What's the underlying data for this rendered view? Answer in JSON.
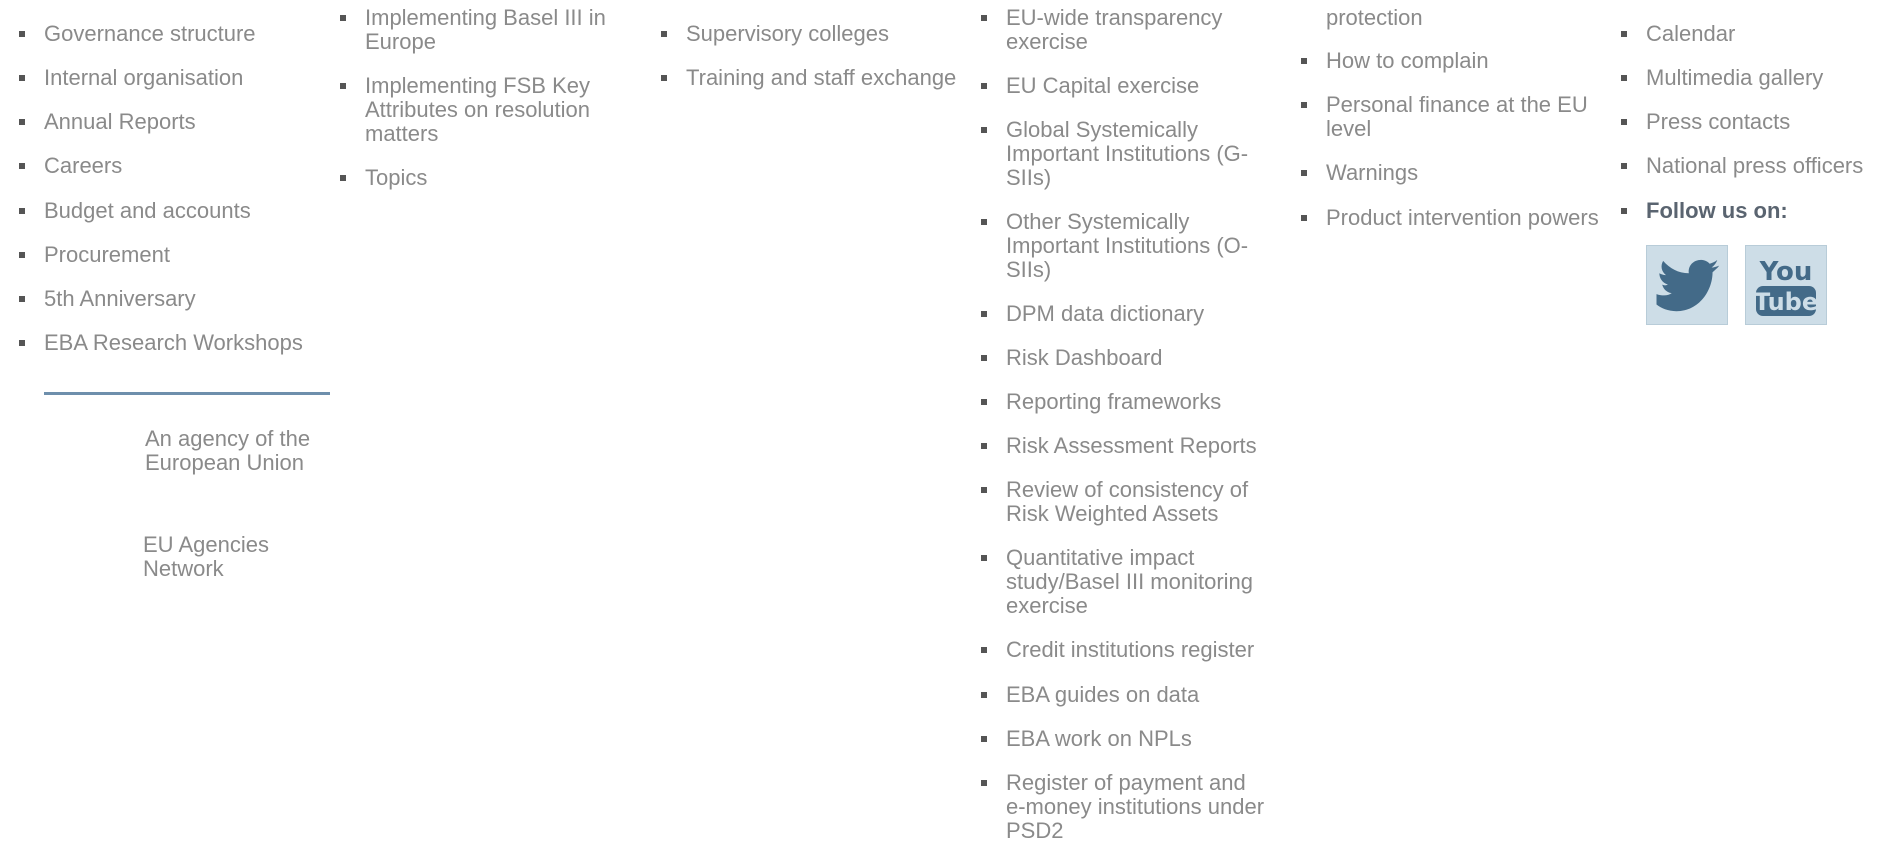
{
  "columns": [
    {
      "items": [
        {
          "label": "Governance structure"
        },
        {
          "label": "Internal organisation"
        },
        {
          "label": "Annual Reports"
        },
        {
          "label": "Careers"
        },
        {
          "label": "Budget and accounts"
        },
        {
          "label": "Procurement"
        },
        {
          "label": "5th Anniversary"
        },
        {
          "label": "EBA Research Workshops"
        }
      ]
    },
    {
      "items": [
        {
          "label": "Implementing Basel III in Europe"
        },
        {
          "label": "Implementing FSB Key Attributes on resolution matters"
        },
        {
          "label": "Topics"
        }
      ]
    },
    {
      "items": [
        {
          "label": "Supervisory colleges"
        },
        {
          "label": "Training and staff exchange"
        }
      ]
    },
    {
      "items": [
        {
          "label": "EU-wide transparency exercise"
        },
        {
          "label": "EU Capital exercise"
        },
        {
          "label": "Global Systemically Important Institutions (G-SIIs)"
        },
        {
          "label": "Other Systemically Important Institutions (O-SIIs)"
        },
        {
          "label": "DPM data dictionary"
        },
        {
          "label": "Risk Dashboard"
        },
        {
          "label": "Reporting frameworks"
        },
        {
          "label": "Risk Assessment Reports"
        },
        {
          "label": "Review of consistency of Risk Weighted Assets"
        },
        {
          "label": "Quantitative impact study/Basel III monitoring exercise"
        },
        {
          "label": "Credit institutions register"
        },
        {
          "label": "EBA guides on data"
        },
        {
          "label": "EBA work on NPLs"
        },
        {
          "label": "Register of payment and e-money institutions under PSD2"
        }
      ]
    },
    {
      "partial_top": "protection",
      "items": [
        {
          "label": "How to complain"
        },
        {
          "label": "Personal finance at the EU level"
        },
        {
          "label": "Warnings"
        },
        {
          "label": "Product intervention powers"
        }
      ]
    },
    {
      "items": [
        {
          "label": "Calendar"
        },
        {
          "label": "Multimedia gallery"
        },
        {
          "label": "Press contacts"
        },
        {
          "label": "National press officers"
        }
      ],
      "follow_label": "Follow us on:"
    }
  ],
  "footer": {
    "agency_text": "An agency of the European Union",
    "network_text": "EU Agencies Network"
  },
  "social": {
    "twitter_icon": "twitter-bird-icon",
    "youtube_label_top": "You",
    "youtube_label_bottom": "Tube"
  },
  "colors": {
    "link_text": "#8a8a8a",
    "bullet": "#555555",
    "divider": "#6e8fac",
    "social_bg": "#cddde7",
    "social_icon": "#436a88"
  }
}
